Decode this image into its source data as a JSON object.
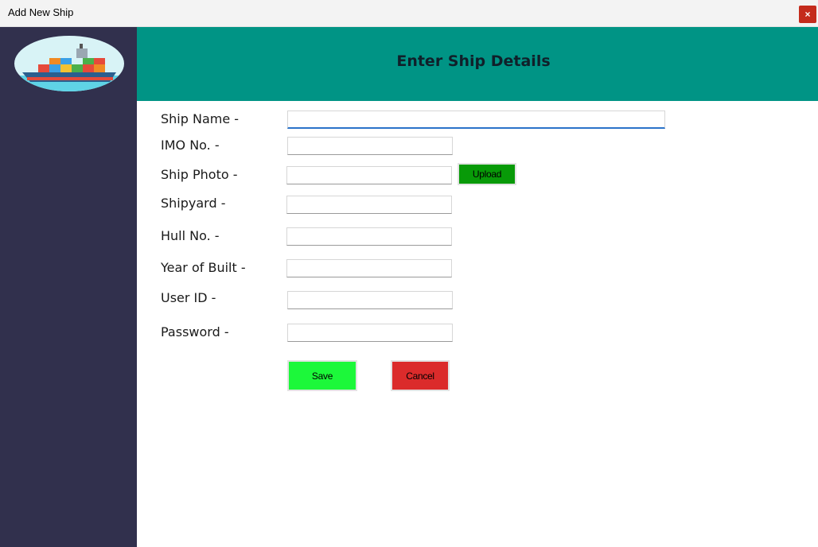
{
  "window": {
    "title": "Add New Ship",
    "close_label": "×"
  },
  "header": {
    "title": "Enter Ship Details"
  },
  "form": {
    "ship_name_label": "Ship Name -",
    "imo_label": "IMO No. -",
    "ship_photo_label": "Ship Photo -",
    "shipyard_label": "Shipyard -",
    "hull_label": "Hull No. -",
    "year_label": "Year of Built -",
    "user_id_label": "User ID -",
    "password_label": "Password -",
    "ship_name_value": "",
    "imo_value": "",
    "ship_photo_value": "",
    "shipyard_value": "",
    "hull_value": "",
    "year_value": "",
    "user_id_value": "",
    "password_value": ""
  },
  "buttons": {
    "upload": "Upload",
    "save": "Save",
    "cancel": "Cancel"
  },
  "colors": {
    "sidebar": "#31304d",
    "header": "#009485",
    "upload": "#089a08",
    "save": "#1cf83a",
    "cancel": "#db2b2b",
    "close": "#c42b1c"
  }
}
